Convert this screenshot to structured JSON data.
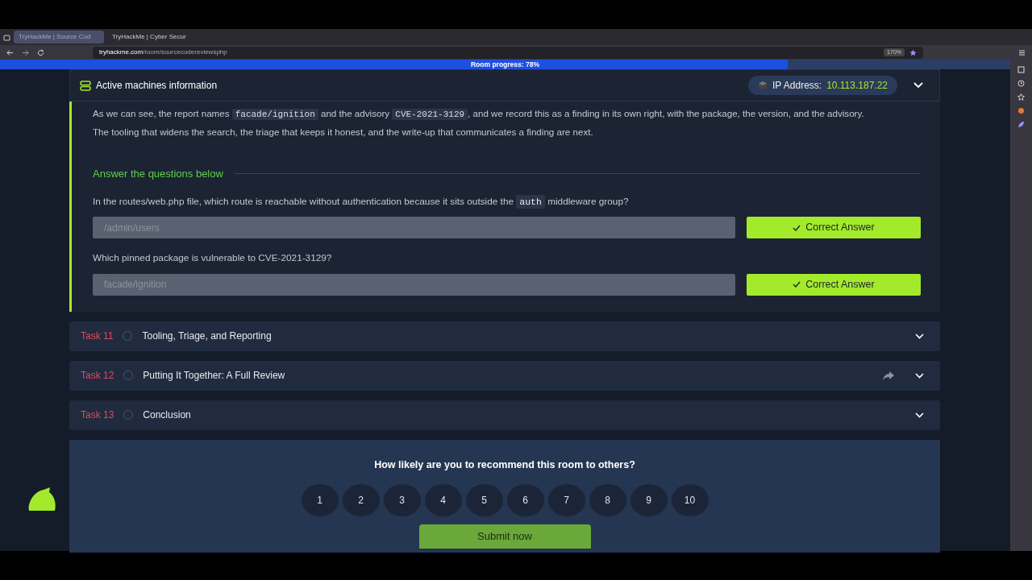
{
  "browser": {
    "tabs": [
      {
        "label": "TryHackMe | Source Cod",
        "selected": true
      },
      {
        "label": "TryHackMe | Cyber Secur",
        "selected": false
      }
    ],
    "url_host": "tryhackme.com",
    "url_path": "/room/sourcecodereviewsphp",
    "zoom": "170%"
  },
  "progress": {
    "label": "Room progress: 78%",
    "level": 0.78
  },
  "machines": {
    "title": "Active machines information",
    "ip_label": "IP Address:",
    "ip": "10.113.187.22"
  },
  "paragraphs": [
    [
      {
        "text": "As we can see, the report names ",
        "code": false
      },
      {
        "text": "facade/ignition",
        "code": true
      },
      {
        "text": " and the advisory ",
        "code": false
      },
      {
        "text": "CVE-2021-3129",
        "code": true
      },
      {
        "text": ", and we record this as a finding in its own right, with the package, the version, and the advisory.",
        "code": false
      }
    ],
    [
      {
        "text": "The tooling that widens the search, the triage that keeps it honest, and the write-up that communicates a finding are next.",
        "code": false
      }
    ]
  ],
  "answers_heading": "Answer the questions below",
  "questions": [
    {
      "text": [
        {
          "text": "In the routes/web.php file, which route is reachable without authentication because it sits outside the ",
          "code": false
        },
        {
          "text": "auth",
          "code": true
        },
        {
          "text": " middleware group?",
          "code": false
        }
      ],
      "value": "/admin/users",
      "correct": true,
      "button": "Correct Answer"
    },
    {
      "text": [
        {
          "text": "Which pinned package is vulnerable to CVE-2021-3129?",
          "code": false
        }
      ],
      "value": "facade/ignition",
      "correct": true,
      "button": "Correct Answer"
    }
  ],
  "tasks": [
    {
      "number": "Task 11",
      "title": "Tooling, Triage, and Reporting",
      "completed": false,
      "share": false
    },
    {
      "number": "Task 12",
      "title": "Putting It Together: A Full Review",
      "completed": false,
      "share": true
    },
    {
      "number": "Task 13",
      "title": "Conclusion",
      "completed": false,
      "share": false
    }
  ],
  "survey": {
    "question": "How likely are you to recommend this room to others?",
    "options": [
      {
        "label": "1",
        "selected": false
      },
      {
        "label": "2",
        "selected": false
      },
      {
        "label": "3",
        "selected": false
      },
      {
        "label": "4",
        "selected": false
      },
      {
        "label": "5",
        "selected": false
      },
      {
        "label": "6",
        "selected": false
      },
      {
        "label": "7",
        "selected": false
      },
      {
        "label": "8",
        "selected": false
      },
      {
        "label": "9",
        "selected": false
      },
      {
        "label": "10",
        "selected": false
      }
    ],
    "submit": "Submit now"
  }
}
